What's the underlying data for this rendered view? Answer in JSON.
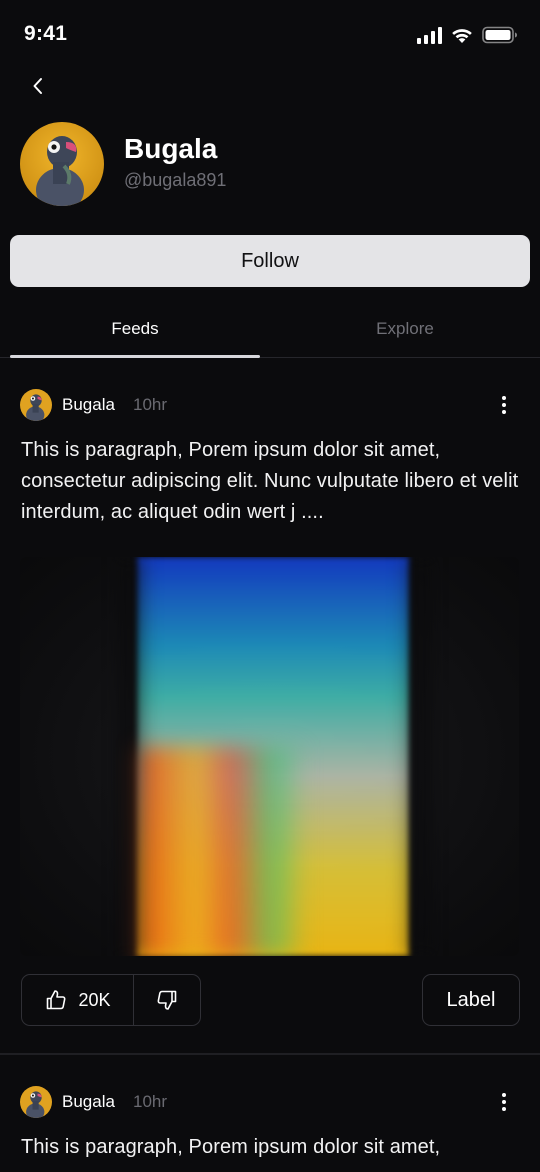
{
  "status_bar": {
    "time": "9:41"
  },
  "profile": {
    "name": "Bugala",
    "handle": "@bugala891",
    "follow_label": "Follow"
  },
  "tabs": [
    {
      "label": "Feeds",
      "active": true
    },
    {
      "label": "Explore",
      "active": false
    }
  ],
  "posts": [
    {
      "author": "Bugala",
      "time": "10hr",
      "text": "This is paragraph, Porem ipsum dolor sit amet, consectetur adipiscing elit. Nunc vulputate libero et velit interdum, ac aliquet odin wert j ....",
      "likes": "20K",
      "label": "Label"
    },
    {
      "author": "Bugala",
      "time": "10hr",
      "text": "This is paragraph, Porem ipsum dolor sit amet,"
    }
  ],
  "icons": {
    "back": "chevron-left-icon",
    "more": "more-vertical-icon",
    "like": "thumbs-up-icon",
    "dislike": "thumbs-down-icon",
    "signal": "cellular-signal-icon",
    "wifi": "wifi-icon",
    "battery": "battery-icon"
  },
  "colors": {
    "background": "#0b0b0d",
    "button_bg": "#e4e4e7",
    "muted_text": "#6f6f76",
    "border": "#303036"
  }
}
